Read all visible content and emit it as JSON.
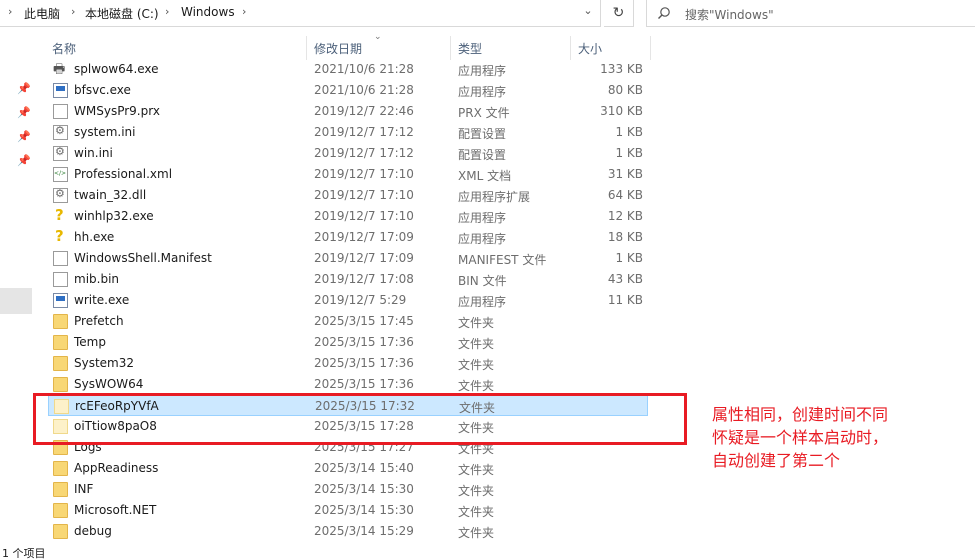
{
  "address": {
    "crumbs": [
      "此电脑",
      "本地磁盘 (C:)",
      "Windows"
    ],
    "dropdown_icon": "chevron-down-icon",
    "refresh_icon": "refresh-icon"
  },
  "search": {
    "placeholder": "搜索\"Windows\""
  },
  "columns": {
    "name": "名称",
    "date": "修改日期",
    "type": "类型",
    "size": "大小"
  },
  "files": [
    {
      "name": "splwow64.exe",
      "date": "2021/10/6 21:28",
      "type": "应用程序",
      "size": "133 KB",
      "icon": "printer-icon"
    },
    {
      "name": "bfsvc.exe",
      "date": "2021/10/6 21:28",
      "type": "应用程序",
      "size": "80 KB",
      "icon": "exe-icon"
    },
    {
      "name": "WMSysPr9.prx",
      "date": "2019/12/7 22:46",
      "type": "PRX 文件",
      "size": "310 KB",
      "icon": "file-icon"
    },
    {
      "name": "system.ini",
      "date": "2019/12/7 17:12",
      "type": "配置设置",
      "size": "1 KB",
      "icon": "settings-file-icon"
    },
    {
      "name": "win.ini",
      "date": "2019/12/7 17:12",
      "type": "配置设置",
      "size": "1 KB",
      "icon": "settings-file-icon"
    },
    {
      "name": "Professional.xml",
      "date": "2019/12/7 17:10",
      "type": "XML 文档",
      "size": "31 KB",
      "icon": "xml-file-icon"
    },
    {
      "name": "twain_32.dll",
      "date": "2019/12/7 17:10",
      "type": "应用程序扩展",
      "size": "64 KB",
      "icon": "settings-file-icon"
    },
    {
      "name": "winhlp32.exe",
      "date": "2019/12/7 17:10",
      "type": "应用程序",
      "size": "12 KB",
      "icon": "help-icon"
    },
    {
      "name": "hh.exe",
      "date": "2019/12/7 17:09",
      "type": "应用程序",
      "size": "18 KB",
      "icon": "help-icon"
    },
    {
      "name": "WindowsShell.Manifest",
      "date": "2019/12/7 17:09",
      "type": "MANIFEST 文件",
      "size": "1 KB",
      "icon": "file-icon"
    },
    {
      "name": "mib.bin",
      "date": "2019/12/7 17:08",
      "type": "BIN 文件",
      "size": "43 KB",
      "icon": "file-icon"
    },
    {
      "name": "write.exe",
      "date": "2019/12/7 5:29",
      "type": "应用程序",
      "size": "11 KB",
      "icon": "exe-icon"
    },
    {
      "name": "Prefetch",
      "date": "2025/3/15 17:45",
      "type": "文件夹",
      "size": "",
      "icon": "folder-icon"
    },
    {
      "name": "Temp",
      "date": "2025/3/15 17:36",
      "type": "文件夹",
      "size": "",
      "icon": "folder-icon"
    },
    {
      "name": "System32",
      "date": "2025/3/15 17:36",
      "type": "文件夹",
      "size": "",
      "icon": "folder-icon"
    },
    {
      "name": "SysWOW64",
      "date": "2025/3/15 17:36",
      "type": "文件夹",
      "size": "",
      "icon": "folder-icon"
    },
    {
      "name": "rcEFeoRpYVfA",
      "date": "2025/3/15 17:32",
      "type": "文件夹",
      "size": "",
      "icon": "folder-icon",
      "selected": true
    },
    {
      "name": "oiTtiow8paO8",
      "date": "2025/3/15 17:28",
      "type": "文件夹",
      "size": "",
      "icon": "folder-icon"
    },
    {
      "name": "Logs",
      "date": "2025/3/15 17:27",
      "type": "文件夹",
      "size": "",
      "icon": "folder-icon"
    },
    {
      "name": "AppReadiness",
      "date": "2025/3/14 15:40",
      "type": "文件夹",
      "size": "",
      "icon": "folder-icon"
    },
    {
      "name": "INF",
      "date": "2025/3/14 15:30",
      "type": "文件夹",
      "size": "",
      "icon": "folder-icon"
    },
    {
      "name": "Microsoft.NET",
      "date": "2025/3/14 15:30",
      "type": "文件夹",
      "size": "",
      "icon": "folder-icon"
    },
    {
      "name": "debug",
      "date": "2025/3/14 15:29",
      "type": "文件夹",
      "size": "",
      "icon": "folder-icon"
    }
  ],
  "status": {
    "text": "1 个项目"
  },
  "annotation": {
    "lines": [
      "属性相同，创建时间不同",
      "怀疑是一个样本启动时，",
      "自动创建了第二个"
    ],
    "color": "#e81b23"
  }
}
